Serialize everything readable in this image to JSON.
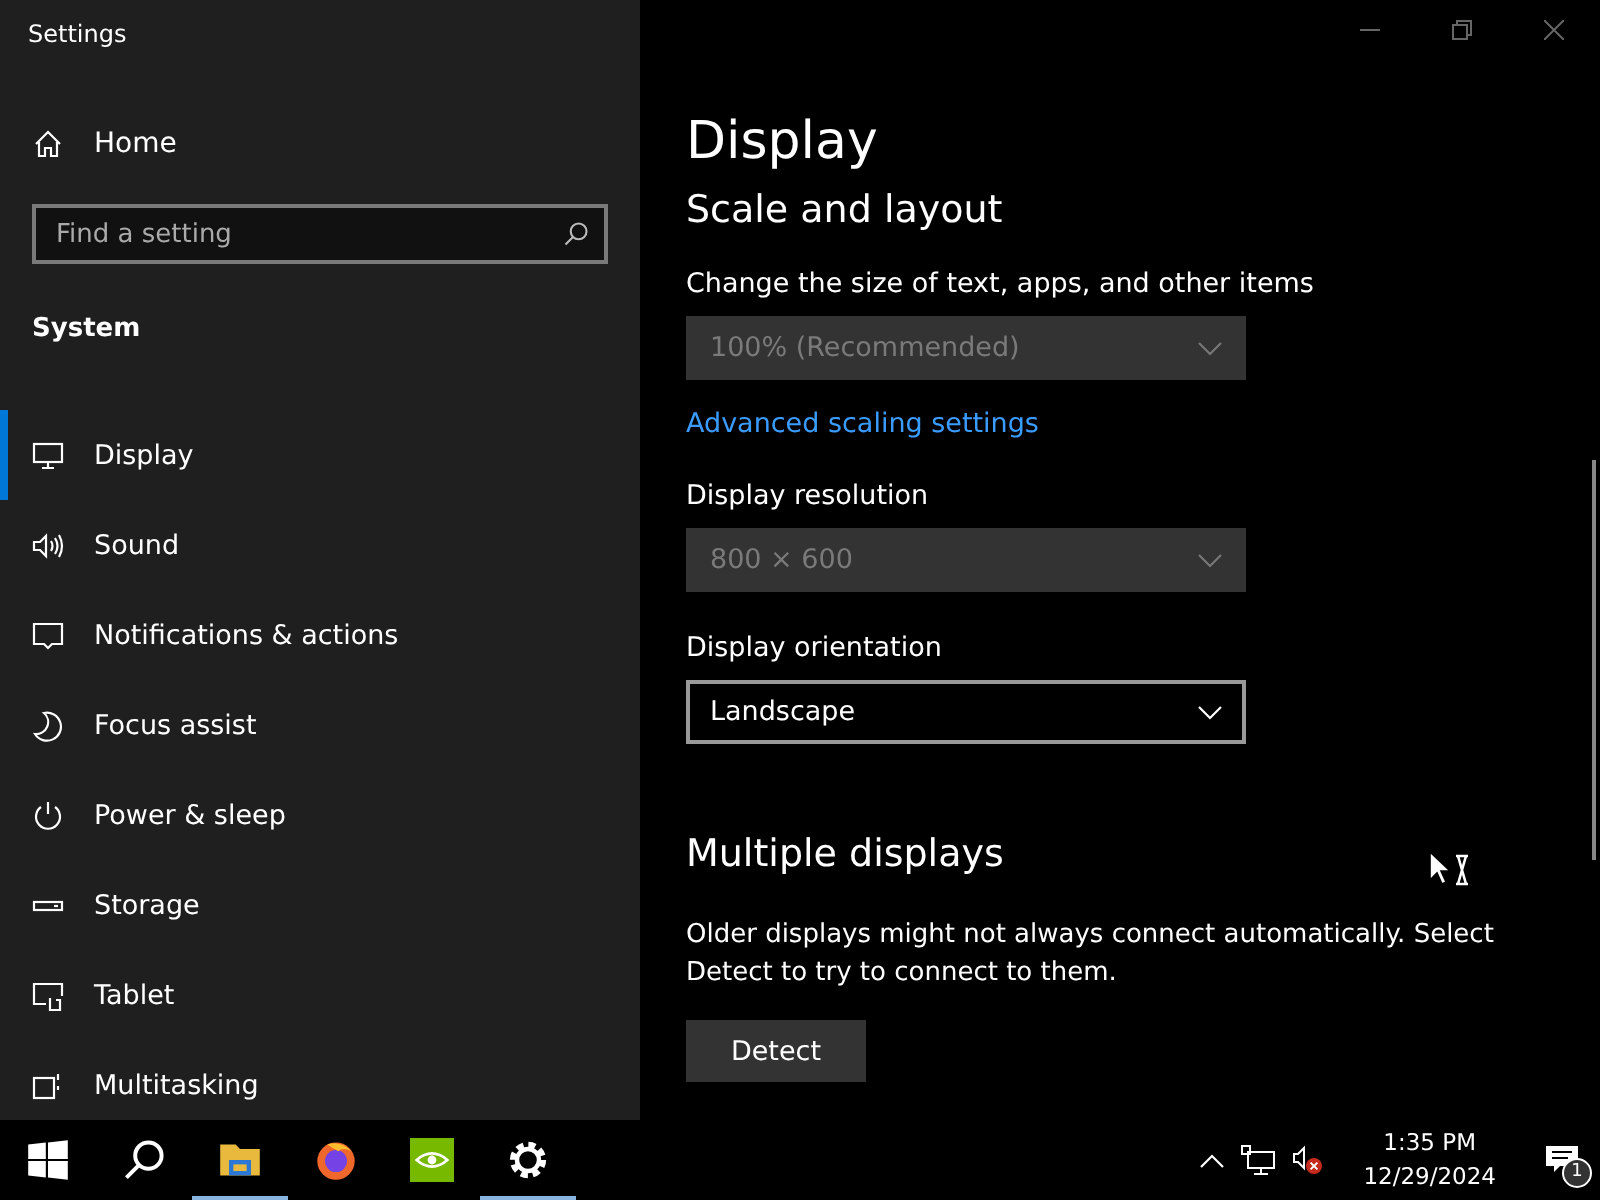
{
  "window": {
    "title": "Settings"
  },
  "sidebar": {
    "home": "Home",
    "search": {
      "placeholder": "Find a setting"
    },
    "section": "System",
    "items": [
      {
        "label": "Display",
        "kind": "display",
        "selected": true
      },
      {
        "label": "Sound",
        "kind": "sound",
        "selected": false
      },
      {
        "label": "Notifications & actions",
        "kind": "notifications",
        "selected": false
      },
      {
        "label": "Focus assist",
        "kind": "moon",
        "selected": false
      },
      {
        "label": "Power & sleep",
        "kind": "power",
        "selected": false
      },
      {
        "label": "Storage",
        "kind": "storage",
        "selected": false
      },
      {
        "label": "Tablet",
        "kind": "tablet",
        "selected": false
      },
      {
        "label": "Multitasking",
        "kind": "multitasking",
        "selected": false
      }
    ]
  },
  "content": {
    "title": "Display",
    "section": "Scale and layout",
    "fields": [
      {
        "kind": "dropdown",
        "label": "Change the size of text, apps, and other items",
        "value": "100% (Recommended)",
        "disabled": true
      },
      {
        "kind": "link",
        "text": "Advanced scaling settings"
      },
      {
        "kind": "dropdown",
        "label": "Display resolution",
        "value": "800 × 600",
        "disabled": true
      },
      {
        "kind": "dropdown",
        "label": "Display orientation",
        "value": "Landscape",
        "disabled": false
      }
    ],
    "section2": "Multiple displays",
    "description": "Older displays might not always connect automatically. Select Detect to try to connect to them.",
    "button": "Detect"
  },
  "taskbar": {
    "apps": [
      {
        "kind": "start",
        "running": false
      },
      {
        "kind": "search",
        "running": false
      },
      {
        "kind": "folder",
        "running": true
      },
      {
        "kind": "browser",
        "running": false
      },
      {
        "kind": "nvidia",
        "running": false
      },
      {
        "kind": "gear",
        "running": true
      }
    ],
    "time": "1:35 PM",
    "date": "12/29/2024",
    "notification_count": "1"
  }
}
